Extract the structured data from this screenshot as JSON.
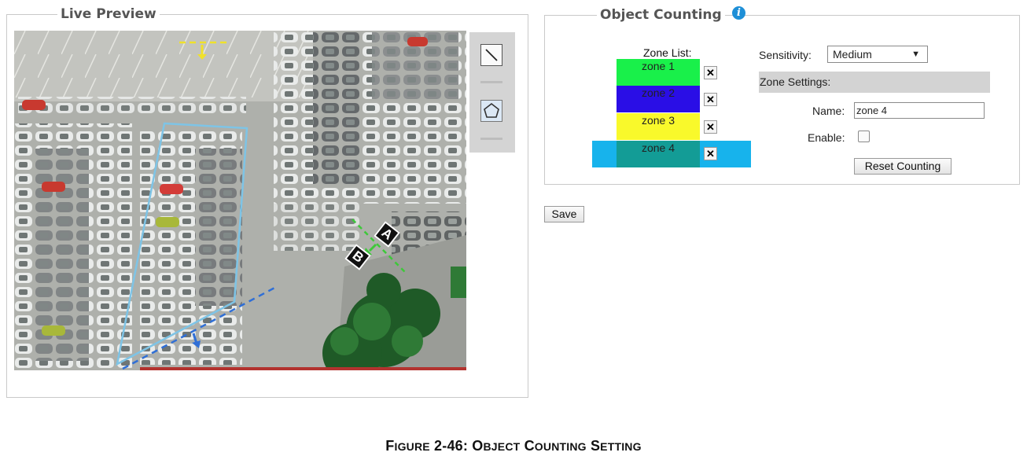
{
  "live_preview": {
    "title": "Live Preview",
    "line_markers": [
      "A",
      "B"
    ]
  },
  "object_counting": {
    "title": "Object Counting",
    "info_icon": "i",
    "zone_list_label": "Zone List:",
    "zones": [
      {
        "label": "zone 1",
        "color": "#19f04a"
      },
      {
        "label": "zone 2",
        "color": "#2a0ee6"
      },
      {
        "label": "zone 3",
        "color": "#f9f92b"
      },
      {
        "label": "zone 4",
        "color": "#139c96"
      }
    ],
    "selected_zone_highlight": "#17b3ec",
    "delete_glyph": "✕",
    "sensitivity_label": "Sensitivity:",
    "sensitivity_value": "Medium",
    "zone_settings_header": "Zone Settings:",
    "name_label": "Name:",
    "name_value": "zone 4",
    "enable_label": "Enable:",
    "enable_checked": false,
    "reset_button": "Reset Counting"
  },
  "save_button": "Save",
  "caption": {
    "prefix_big": "F",
    "prefix_small": "IGURE",
    "number": "2-46:",
    "w1_big": "O",
    "w1_small": "BJECT",
    "w2_big": "C",
    "w2_small": "OUNTING",
    "w3_big": "S",
    "w3_small": "ETTING"
  }
}
